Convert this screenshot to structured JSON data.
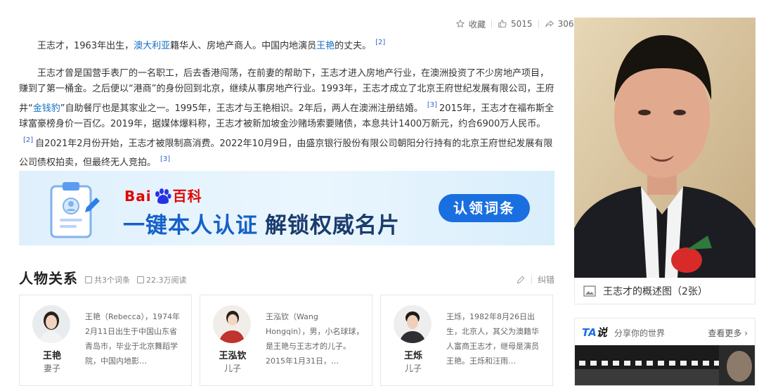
{
  "actions": {
    "collect": "收藏",
    "like_count": "5015",
    "share_count": "306"
  },
  "article": {
    "p1": {
      "a": "王志才，1963年出生，",
      "link1": "澳大利亚",
      "b": "籍华人、房地产商人。中国内地演员",
      "link2": "王艳",
      "c": "的丈夫。",
      "ref": "[2]"
    },
    "p2": {
      "a": "王志才曾是国营手表厂的一名职工，后去香港闯荡，在前妻的帮助下，王志才进入房地产行业，在澳洲投资了不少房地产项目，赚到了第一桶金。之后便以“港商”的身份回到北京，继续从事房地产行业。1993年，王志才成立了北京王府世纪发展有限公司，王府井“",
      "link": "金钱豹",
      "b": "”自助餐厅也是其家业之一。1995年，王志才与王艳相识。2年后，两人在澳洲注册结婚。",
      "ref1": "[3]",
      "c": "2015年，王志才在福布斯全球富豪榜身价一百亿。2019年，据媒体爆料称，王志才被新加坡金沙赌场索要赌债，本息共计1400万新元，约合6900万人民币。",
      "ref2": "[2]",
      "d": "自2021年2月份开始，王志才被限制高消费。2022年10月9日，由盛京银行股份有限公司朝阳分行持有的北京王府世纪发展有限公司债权拍卖，但最终无人竞拍。",
      "ref3": "[3]"
    }
  },
  "banner": {
    "brand_a": "Bai",
    "brand_b": "百科",
    "headline_a": "一键本人认证",
    "headline_b": "解锁权威名片",
    "cta": "认领词条"
  },
  "relations": {
    "title": "人物关系",
    "entries": "共3个词条",
    "reads": "22.3万阅读",
    "edit": "纠错",
    "cards": [
      {
        "name": "王艳",
        "role": "妻子",
        "desc": "王艳（Rebecca），1974年2月11日出生于中国山东省青岛市，毕业于北京舞蹈学院，中国内地影…"
      },
      {
        "name": "王泓钦",
        "role": "儿子",
        "desc": "王泓钦（Wang Hongqin），男，小名球球，是王艳与王志才的儿子。2015年1月31日，…"
      },
      {
        "name": "王烁",
        "role": "儿子",
        "desc": "王烁，1982年8月26日出生，北京人，其父为澳籍华人富商王志才，继母是演员王艳。王烁和汪雨…"
      }
    ]
  },
  "sidebar": {
    "caption": "王志才的概述图（2张）",
    "ta_logo_a": "TA",
    "ta_logo_b": "说",
    "ta_slogan": "分享你的世界",
    "ta_more": "查看更多 ›"
  },
  "colors": {
    "link": "#136ec2",
    "brand_red": "#e10602",
    "accent_blue": "#1a6fe0"
  }
}
